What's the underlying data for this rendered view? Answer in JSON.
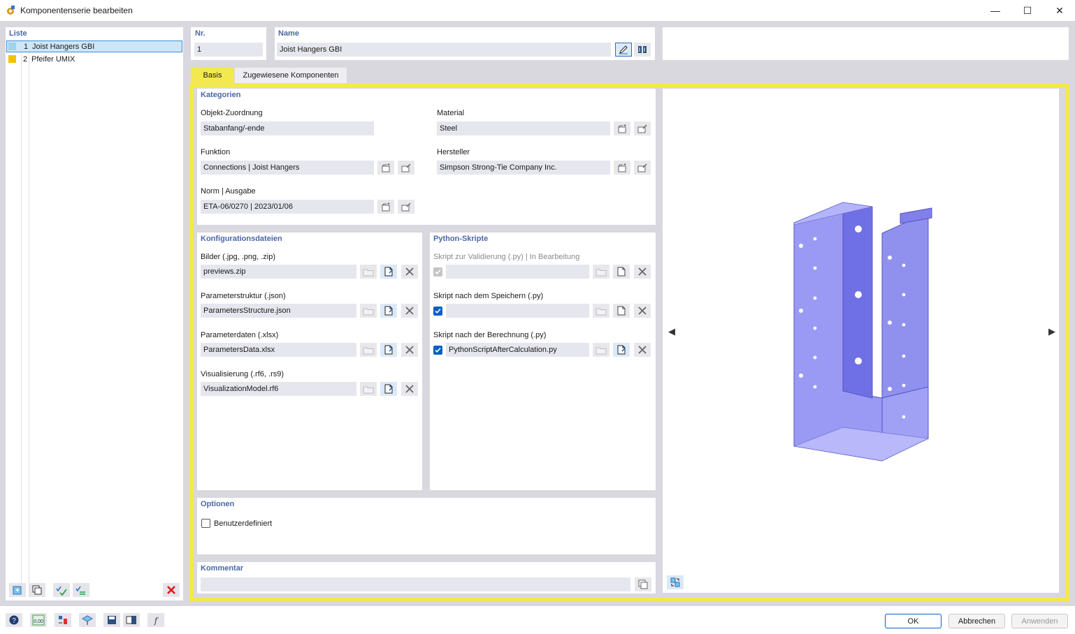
{
  "window": {
    "title": "Komponentenserie bearbeiten",
    "minimize_glyph": "—",
    "maximize_glyph": "☐",
    "close_glyph": "✕"
  },
  "list": {
    "header": "Liste",
    "items": [
      {
        "no": "1",
        "name": "Joist Hangers GBI",
        "color": "#9fd3ee",
        "selected": true
      },
      {
        "no": "2",
        "name": "Pfeifer UMIX",
        "color": "#f2c300",
        "selected": false
      }
    ],
    "toolbar_icons": [
      "new-icon",
      "copy-icon",
      "check-all-icon",
      "check-toggle-icon"
    ],
    "delete_icon": "delete-x-icon"
  },
  "nr": {
    "label": "Nr.",
    "value": "1"
  },
  "name": {
    "label": "Name",
    "value": "Joist Hangers GBI"
  },
  "tabs": [
    {
      "label": "Basis",
      "active": true
    },
    {
      "label": "Zugewiesene Komponenten",
      "active": false
    }
  ],
  "highlight_color": "#f2e94e",
  "kategorien": {
    "header": "Kategorien",
    "objekt_label": "Objekt-Zuordnung",
    "objekt_value": "Stabanfang/-ende",
    "funktion_label": "Funktion",
    "funktion_value": "Connections | Joist Hangers",
    "norm_label": "Norm | Ausgabe",
    "norm_value": "ETA-06/0270 | 2023/01/06",
    "material_label": "Material",
    "material_value": "Steel",
    "hersteller_label": "Hersteller",
    "hersteller_value": "Simpson Strong-Tie Company Inc."
  },
  "konfig": {
    "header": "Konfigurationsdateien",
    "rows": [
      {
        "label": "Bilder (.jpg, .png, .zip)",
        "value": "previews.zip"
      },
      {
        "label": "Parameterstruktur (.json)",
        "value": "ParametersStructure.json"
      },
      {
        "label": "Parameterdaten (.xlsx)",
        "value": "ParametersData.xlsx"
      },
      {
        "label": "Visualisierung (.rf6, .rs9)",
        "value": "VisualizationModel.rf6"
      }
    ]
  },
  "python": {
    "header": "Python-Skripte",
    "rows": [
      {
        "label": "Skript zur Validierung (.py) | In Bearbeitung",
        "value": "",
        "checked": true,
        "disabled": true
      },
      {
        "label": "Skript nach dem Speichern (.py)",
        "value": "",
        "checked": true,
        "disabled": false
      },
      {
        "label": "Skript nach der Berechnung (.py)",
        "value": "PythonScriptAfterCalculation.py",
        "checked": true,
        "disabled": false
      }
    ]
  },
  "optionen": {
    "header": "Optionen",
    "benutzer_label": "Benutzerdefiniert",
    "benutzer_checked": false
  },
  "kommentar": {
    "header": "Kommentar",
    "value": ""
  },
  "preview": {
    "prev_glyph": "◀",
    "next_glyph": "▶",
    "model_color": "#8c8cf0"
  },
  "footer": {
    "icons": [
      "help-icon",
      "units-icon",
      "model-icon",
      "view-icon",
      "save-icon",
      "load-icon",
      "formula-icon"
    ],
    "ok": "OK",
    "abbrechen": "Abbrechen",
    "anwenden": "Anwenden"
  }
}
